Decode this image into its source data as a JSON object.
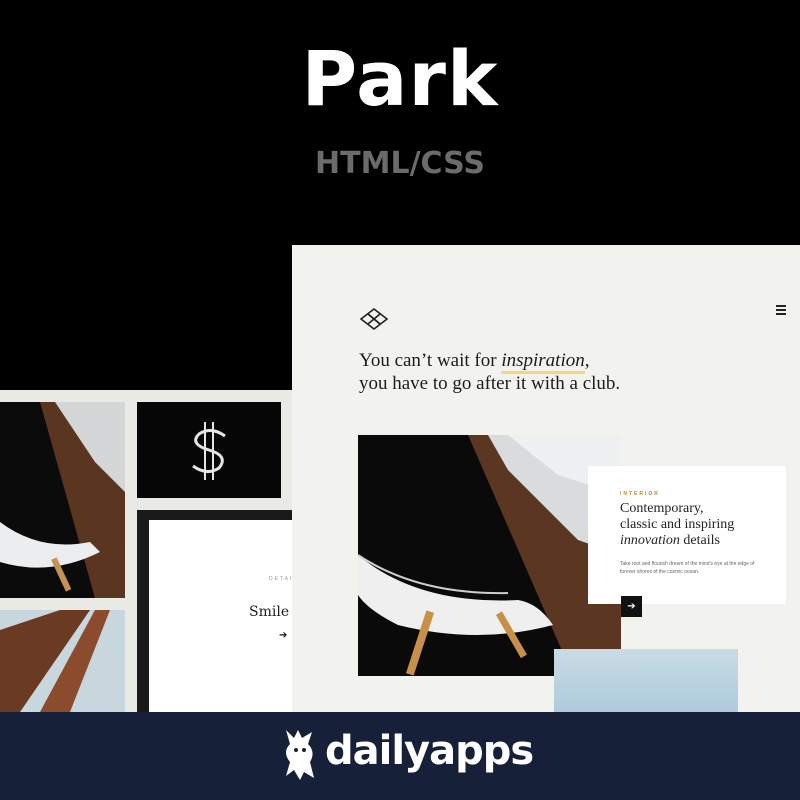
{
  "header": {
    "title": "Park",
    "subtitle": "HTML/CSS"
  },
  "collage": {
    "smile_label": "DETAIL",
    "smile_text": "Smile t",
    "arrow": "➔",
    "dollar_icon": "dollar-logo-icon"
  },
  "main": {
    "headline_line1_a": "You can’t wait for ",
    "headline_line1_em": "inspiration",
    "headline_line1_b": ",",
    "headline_line2": "you have to go after it with a club.",
    "card": {
      "label": "INTERIOR",
      "title_line1": "Contemporary,",
      "title_line2": "classic and inspiring",
      "title_line3_em": "innovation",
      "title_line3_b": " details",
      "body": "Take root and flourish dream of the mind’s eye at the edge of forever shores of the cosmic ocean."
    },
    "arrow": "➔",
    "menu_icon": "hamburger-menu-icon",
    "logo_icon": "diamond-logo-icon"
  },
  "footer": {
    "brand": "dailyapps",
    "brand_icon": "mascot-logo-icon"
  },
  "colors": {
    "background": "#000000",
    "page": "#f2f2ef",
    "footer": "#172039",
    "highlight": "#f3d77a",
    "accent_label": "#b8892b"
  }
}
